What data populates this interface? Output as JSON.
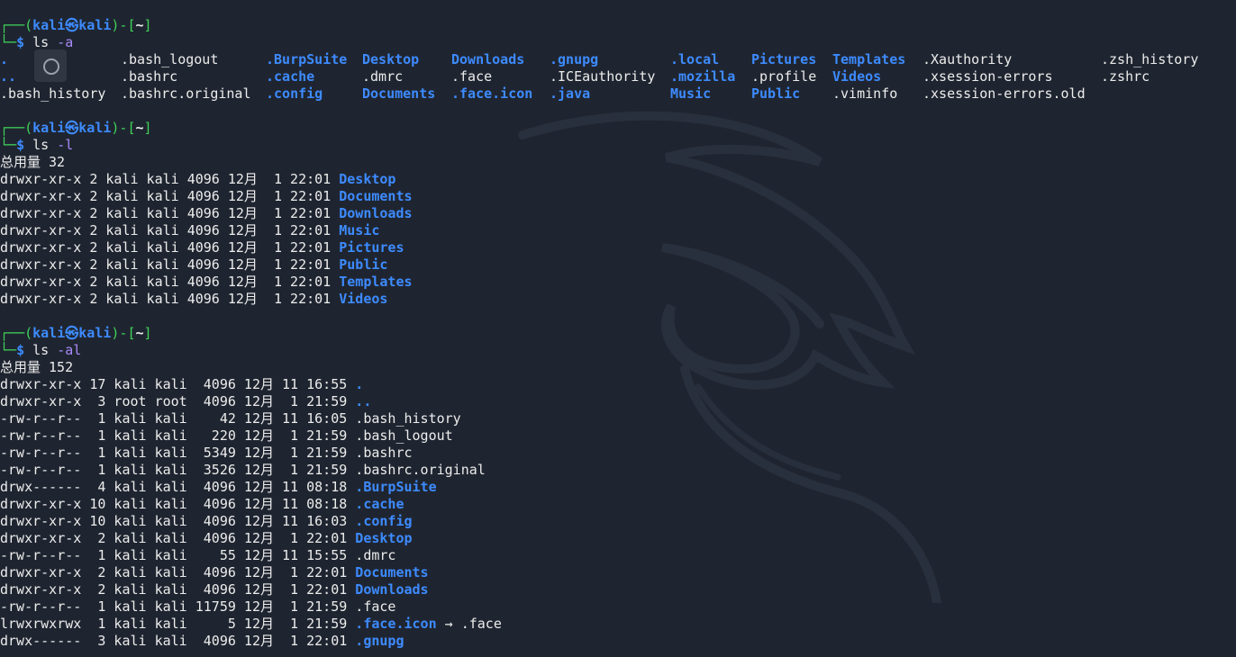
{
  "prompt": {
    "user": "kali",
    "host": "kali",
    "path": "~",
    "symbol": "$"
  },
  "commands": [
    "ls -a",
    "ls -l",
    "ls -al"
  ],
  "ls_a": {
    "rows": [
      [
        ".",
        ".bash_logout",
        ".BurpSuite",
        "Desktop",
        "Downloads",
        ".gnupg",
        ".local",
        "Pictures",
        "Templates",
        ".Xauthority",
        ".zsh_history"
      ],
      [
        "..",
        ".bashrc",
        ".cache",
        ".dmrc",
        ".face",
        ".ICEauthority",
        ".mozilla",
        ".profile",
        "Videos",
        ".xsession-errors",
        ".zshrc"
      ],
      [
        ".bash_history",
        ".bashrc.original",
        ".config",
        "Documents",
        ".face.icon",
        ".java",
        "Music",
        "Public",
        ".viminfo",
        ".xsession-errors.old",
        ""
      ]
    ],
    "blue_flags": [
      [
        true,
        false,
        true,
        true,
        true,
        true,
        true,
        true,
        true,
        false,
        false
      ],
      [
        true,
        false,
        true,
        false,
        false,
        false,
        true,
        false,
        true,
        false,
        false
      ],
      [
        false,
        false,
        true,
        true,
        true,
        true,
        true,
        true,
        false,
        false,
        false
      ]
    ]
  },
  "ls_l": {
    "total": "总用量 32",
    "rows": [
      {
        "perm": "drwxr-xr-x 2 kali kali 4096 12月  1 22:01 ",
        "name": "Desktop"
      },
      {
        "perm": "drwxr-xr-x 2 kali kali 4096 12月  1 22:01 ",
        "name": "Documents"
      },
      {
        "perm": "drwxr-xr-x 2 kali kali 4096 12月  1 22:01 ",
        "name": "Downloads"
      },
      {
        "perm": "drwxr-xr-x 2 kali kali 4096 12月  1 22:01 ",
        "name": "Music"
      },
      {
        "perm": "drwxr-xr-x 2 kali kali 4096 12月  1 22:01 ",
        "name": "Pictures"
      },
      {
        "perm": "drwxr-xr-x 2 kali kali 4096 12月  1 22:01 ",
        "name": "Public"
      },
      {
        "perm": "drwxr-xr-x 2 kali kali 4096 12月  1 22:01 ",
        "name": "Templates"
      },
      {
        "perm": "drwxr-xr-x 2 kali kali 4096 12月  1 22:01 ",
        "name": "Videos"
      }
    ]
  },
  "ls_al": {
    "total": "总用量 152",
    "rows": [
      {
        "perm": "drwxr-xr-x 17 kali kali  4096 12月 11 16:55 ",
        "name": ".",
        "blue": true,
        "suffix": ""
      },
      {
        "perm": "drwxr-xr-x  3 root root  4096 12月  1 21:59 ",
        "name": "..",
        "blue": true,
        "suffix": ""
      },
      {
        "perm": "-rw-r--r--  1 kali kali    42 12月 11 16:05 ",
        "name": ".bash_history",
        "blue": false,
        "suffix": ""
      },
      {
        "perm": "-rw-r--r--  1 kali kali   220 12月  1 21:59 ",
        "name": ".bash_logout",
        "blue": false,
        "suffix": ""
      },
      {
        "perm": "-rw-r--r--  1 kali kali  5349 12月  1 21:59 ",
        "name": ".bashrc",
        "blue": false,
        "suffix": ""
      },
      {
        "perm": "-rw-r--r--  1 kali kali  3526 12月  1 21:59 ",
        "name": ".bashrc.original",
        "blue": false,
        "suffix": ""
      },
      {
        "perm": "drwx------  4 kali kali  4096 12月 11 08:18 ",
        "name": ".BurpSuite",
        "blue": true,
        "suffix": ""
      },
      {
        "perm": "drwxr-xr-x 10 kali kali  4096 12月 11 08:18 ",
        "name": ".cache",
        "blue": true,
        "suffix": ""
      },
      {
        "perm": "drwxr-xr-x 10 kali kali  4096 12月 11 16:03 ",
        "name": ".config",
        "blue": true,
        "suffix": ""
      },
      {
        "perm": "drwxr-xr-x  2 kali kali  4096 12月  1 22:01 ",
        "name": "Desktop",
        "blue": true,
        "suffix": ""
      },
      {
        "perm": "-rw-r--r--  1 kali kali    55 12月 11 15:55 ",
        "name": ".dmrc",
        "blue": false,
        "suffix": ""
      },
      {
        "perm": "drwxr-xr-x  2 kali kali  4096 12月  1 22:01 ",
        "name": "Documents",
        "blue": true,
        "suffix": ""
      },
      {
        "perm": "drwxr-xr-x  2 kali kali  4096 12月  1 22:01 ",
        "name": "Downloads",
        "blue": true,
        "suffix": ""
      },
      {
        "perm": "-rw-r--r--  1 kali kali 11759 12月  1 21:59 ",
        "name": ".face",
        "blue": false,
        "suffix": ""
      },
      {
        "perm": "lrwxrwxrwx  1 kali kali     5 12月  1 21:59 ",
        "name": ".face.icon",
        "blue": true,
        "suffix": " → .face"
      },
      {
        "perm": "drwx------  3 kali kali  4096 12月  1 22:01 ",
        "name": ".gnupg",
        "blue": true,
        "suffix": ""
      }
    ]
  },
  "colors": {
    "background": "#1f2530",
    "prompt_green": "#3fd35a",
    "dir_blue": "#3d8bff",
    "arg_purple": "#a78bfa",
    "text": "#ececec"
  }
}
